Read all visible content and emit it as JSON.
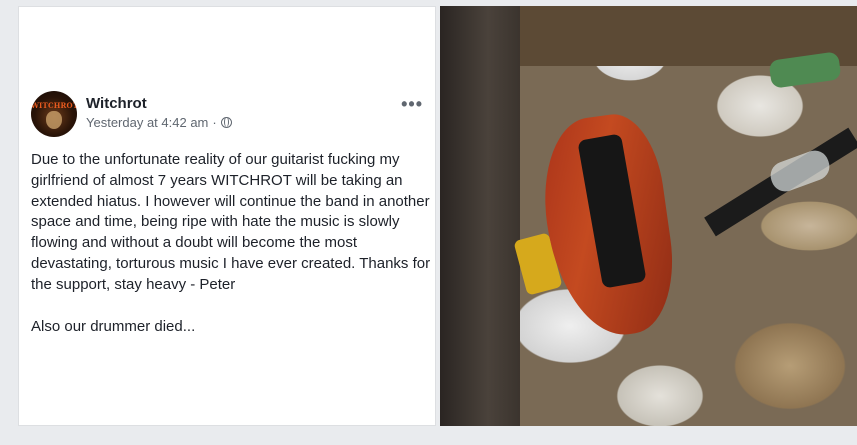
{
  "post": {
    "page_name": "Witchrot",
    "avatar_label": "WITCHROT",
    "timestamp": "Yesterday at 4:42 am",
    "separator": "·",
    "more_label": "•••",
    "body_paragraph_1": "Due to the unfortunate reality of our guitarist fucking my girlfriend of almost 7 years WITCHROT will be taking an extended hiatus. I however will continue the band in another space and time, being ripe with hate the music is slowly flowing and without a doubt will become the most devastating, torturous music I have ever created. Thanks for the support, stay heavy - Peter",
    "body_paragraph_2": "Also our drummer died..."
  },
  "icons": {
    "privacy": "globe-icon",
    "options": "more-icon"
  },
  "colors": {
    "page_background": "#e9ebee",
    "card_background": "#ffffff",
    "text_primary": "#1d2129",
    "text_secondary": "#606770"
  }
}
